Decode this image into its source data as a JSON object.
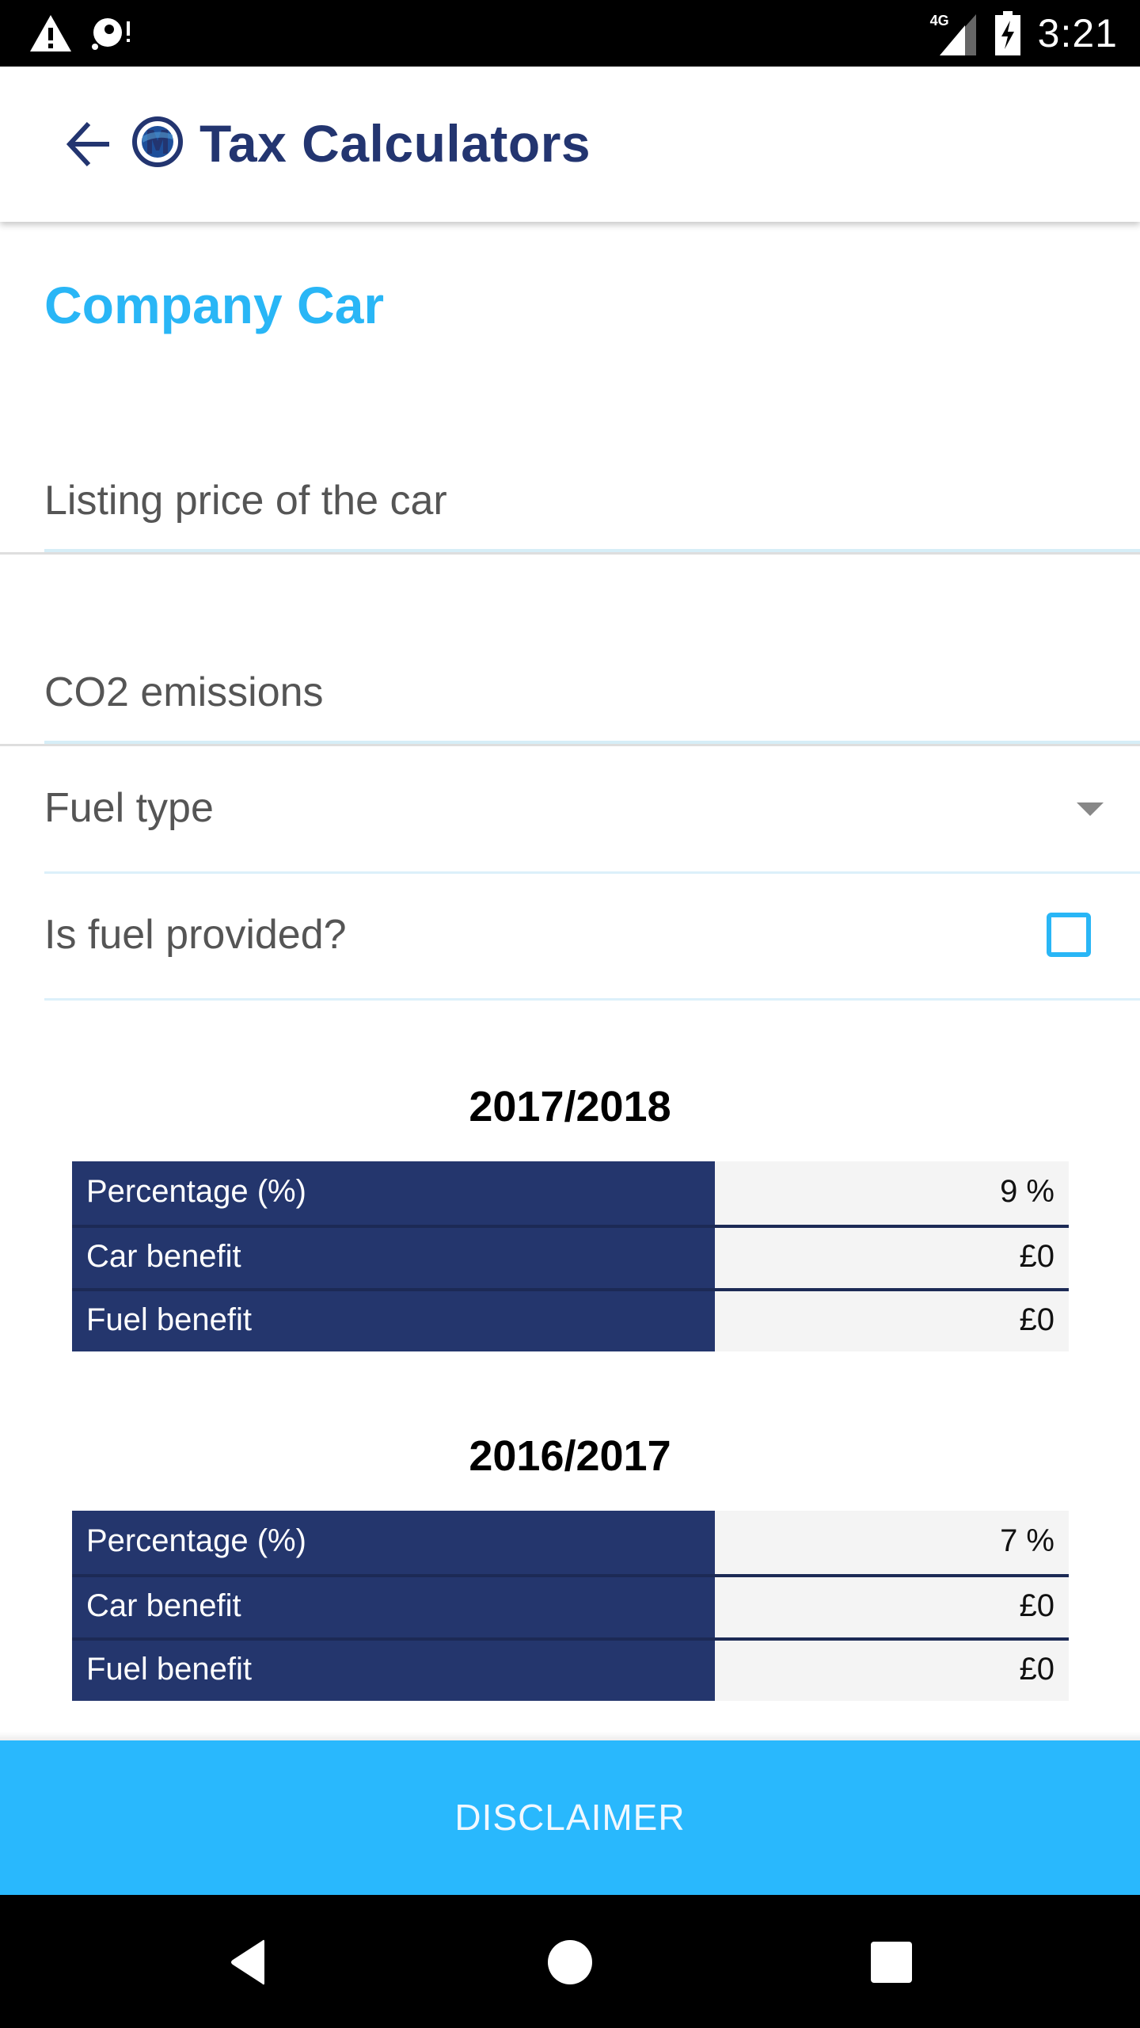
{
  "status_bar": {
    "left_icons": [
      "warning-icon",
      "sync-alert-icon"
    ],
    "network_label": "4G",
    "right_icons": [
      "signal-icon",
      "battery-charging-icon"
    ],
    "time": "3:21"
  },
  "app_bar": {
    "back_icon": "arrow-left-icon",
    "logo_icon": "m-logo-icon",
    "title": "Tax Calculators"
  },
  "page": {
    "title": "Company Car"
  },
  "form": {
    "listing_price": {
      "placeholder": "Listing price of the car",
      "value": ""
    },
    "co2": {
      "placeholder": "CO2 emissions",
      "value": ""
    },
    "fuel_type": {
      "label": "Fuel type",
      "selected": "",
      "icon": "dropdown-arrow-icon"
    },
    "fuel_provided": {
      "label": "Is fuel provided?",
      "checked": false
    }
  },
  "results": [
    {
      "year": "2017/2018",
      "rows": [
        {
          "label": "Percentage (%)",
          "value": "9 %"
        },
        {
          "label": "Car benefit",
          "value": "£0"
        },
        {
          "label": "Fuel benefit",
          "value": "£0"
        }
      ]
    },
    {
      "year": "2016/2017",
      "rows": [
        {
          "label": "Percentage (%)",
          "value": "7 %"
        },
        {
          "label": "Car benefit",
          "value": "£0"
        },
        {
          "label": "Fuel benefit",
          "value": "£0"
        }
      ]
    }
  ],
  "footer": {
    "disclaimer_label": "DISCLAIMER"
  },
  "nav_bar": {
    "buttons": [
      "back-icon",
      "home-icon",
      "recents-icon"
    ]
  },
  "colors": {
    "brand_navy": "#233570",
    "accent_blue": "#29b6f6",
    "table_key_bg": "#24366d",
    "table_value_bg": "#f4f4f4",
    "disclaimer_bg": "#29b8fd"
  }
}
